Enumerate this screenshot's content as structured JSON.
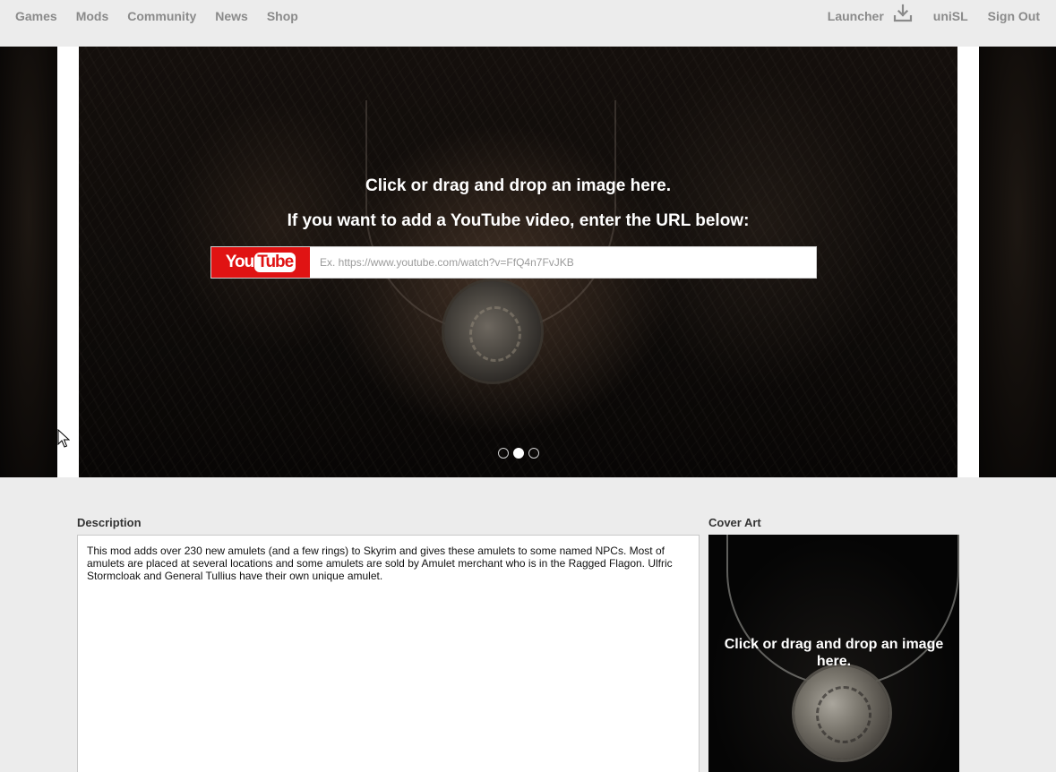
{
  "nav": {
    "left": [
      "Games",
      "Mods",
      "Community",
      "News",
      "Shop"
    ],
    "launcher": "Launcher",
    "download_icon": "download-icon",
    "user": "uniSL",
    "signout": "Sign Out"
  },
  "slider": {
    "drop_text": "Click or drag and drop an image here.",
    "youtube_prompt": "If you want to add a YouTube video, enter the URL below:",
    "youtube_logo_you": "You",
    "youtube_logo_tube": "Tube",
    "youtube_placeholder": "Ex. https://www.youtube.com/watch?v=FfQ4n7FvJKB",
    "youtube_value": "",
    "dots_count": 3,
    "active_dot": 2
  },
  "description": {
    "label": "Description",
    "text": "This mod adds over 230 new amulets (and a few rings) to Skyrim and gives these amulets to some named NPCs. Most of amulets are placed at several locations and some amulets are sold by Amulet merchant who is in the Ragged Flagon. Ulfric Stormcloak and General Tullius have their own unique amulet."
  },
  "cover_art": {
    "label": "Cover Art",
    "drop_text": "Click or drag and drop an image here."
  },
  "colors": {
    "nav_text": "#8a8a8a",
    "youtube_red": "#e01313",
    "page_bg": "#ececec"
  }
}
